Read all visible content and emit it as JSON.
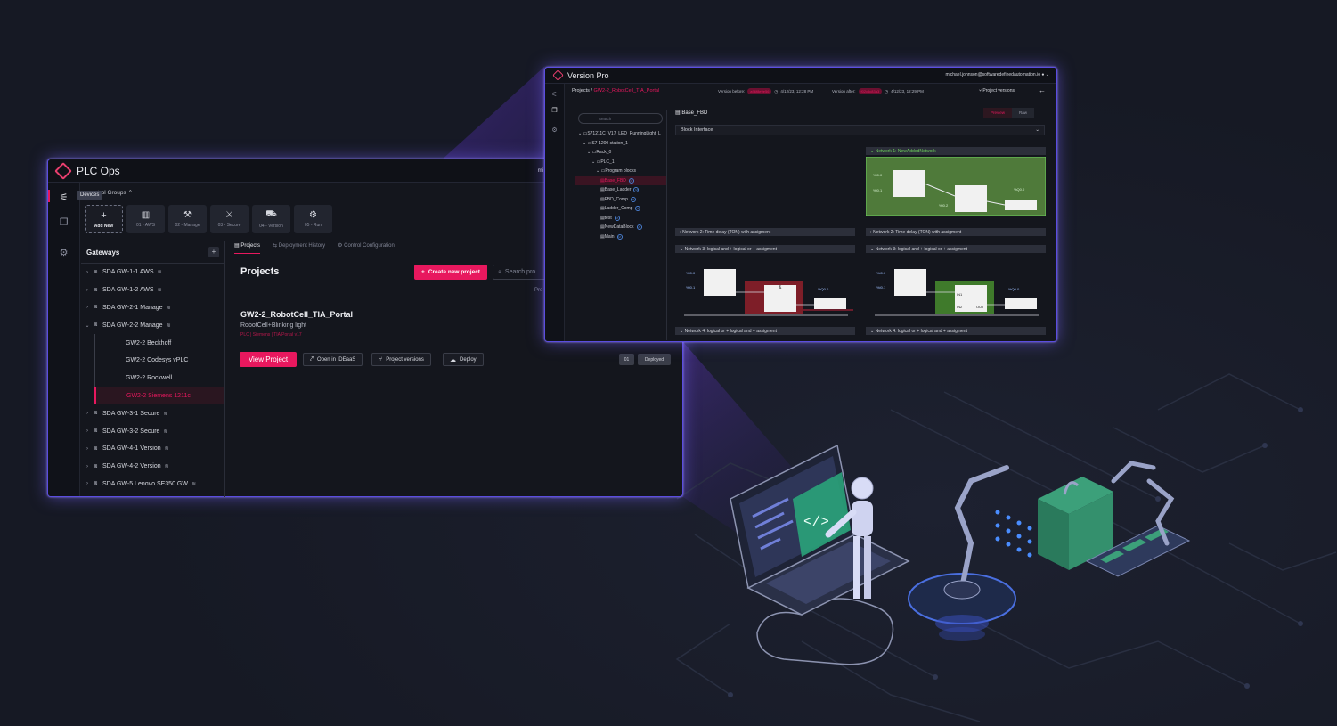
{
  "plc": {
    "title": "PLC Ops",
    "header_user_partial": "mi",
    "tooltip": "Devices",
    "control_groups_label": "ntrol Groups",
    "tiles": [
      {
        "glyph": "+",
        "label": "Add New"
      },
      {
        "glyph": "▥",
        "label": "01 - AWS"
      },
      {
        "glyph": "⚒",
        "label": "02 - Manage"
      },
      {
        "glyph": "⚔",
        "label": "03 - Secure"
      },
      {
        "glyph": "⛟",
        "label": "04 - Version"
      },
      {
        "glyph": "⚙",
        "label": "05 - Run"
      }
    ],
    "gateways_title": "Gateways",
    "gateways": [
      {
        "label": "SDA GW-1-1 AWS",
        "type": "parent"
      },
      {
        "label": "SDA GW-1-2 AWS",
        "type": "parent"
      },
      {
        "label": "SDA GW-2-1 Manage",
        "type": "parent"
      },
      {
        "label": "SDA GW-2-2 Manage",
        "type": "open"
      },
      {
        "label": "GW2-2 Beckhoff",
        "type": "child"
      },
      {
        "label": "GW2-2 Codesys vPLC",
        "type": "child"
      },
      {
        "label": "GW2-2 Rockwell",
        "type": "child"
      },
      {
        "label": "GW2-2 Siemens 1211c",
        "type": "selected"
      },
      {
        "label": "SDA GW-3-1 Secure",
        "type": "parent"
      },
      {
        "label": "SDA GW-3-2 Secure",
        "type": "parent"
      },
      {
        "label": "SDA GW-4-1 Version",
        "type": "parent"
      },
      {
        "label": "SDA GW-4-2 Version",
        "type": "parent"
      },
      {
        "label": "SDA GW-5 Lenovo SE350 GW",
        "type": "parent"
      }
    ],
    "tabs": [
      "Projects",
      "Deployment History",
      "Control Configuration"
    ],
    "page_title": "Projects",
    "create_button": "Create new project",
    "search_placeholder": "Search pro",
    "prefix_text": "Pro",
    "project": {
      "name": "GW2-2_RobotCell_TIA_Portal",
      "subtitle": "RobotCell+Blinking light",
      "tag": "PLC | Siemens | TIA Portal v17",
      "view_button": "View Project",
      "open_button": "Open in IDEaaS",
      "versions_button": "Project versions",
      "deploy_button": "Deploy",
      "version_chip": "01",
      "status_chip": "Deployed"
    }
  },
  "vp": {
    "title": "Version Pro",
    "user": "michael.johnson@softwaredefinedautomation.io",
    "crumb_root": "Projects",
    "crumb_project": "GW2-2_RobotCell_TIA_Portal",
    "version_before_label": "Version before:",
    "version_before_pill": "a96f8e9e56",
    "version_before_time": "4/12/23, 12:28 PM",
    "version_after_label": "Version after:",
    "version_after_pill": "f02c5c83a3",
    "version_after_time": "4/12/23, 12:29 PM",
    "project_versions": "Project versions",
    "search_placeholder": "Search",
    "tree": [
      {
        "label": "S71211C_V17_LED_RunningLight_L",
        "level": 0,
        "badge": ""
      },
      {
        "label": "S7-1200 station_1",
        "level": 1,
        "badge": ""
      },
      {
        "label": "Rack_0",
        "level": 2,
        "badge": ""
      },
      {
        "label": "PLC_1",
        "level": 3,
        "badge": ""
      },
      {
        "label": "Program blocks",
        "level": 4,
        "badge": ""
      },
      {
        "label": "Base_FBD",
        "level": 5,
        "badge": "M",
        "sel": true
      },
      {
        "label": "Base_Ladder",
        "level": 5,
        "badge": "M"
      },
      {
        "label": "FBD_Comp",
        "level": 5,
        "badge": "M"
      },
      {
        "label": "Ladder_Comp",
        "level": 5,
        "badge": "M"
      },
      {
        "label": "test",
        "level": 5,
        "badge": "M"
      },
      {
        "label": "NewDataBlock",
        "level": 5,
        "badge": "A"
      },
      {
        "label": "Main",
        "level": 5,
        "badge": "M"
      }
    ],
    "block_title": "Base_FBD",
    "tab_preview": "Preview",
    "tab_raw": "Raw",
    "block_interface": "Block Interface",
    "net1_added": "Network 1:  NewAddedNetwork",
    "net2_left": "Network 2:  Time delay (TON) with assigment",
    "net2_right": "Network 2:  Time delay (TON) with assigment",
    "net3_left": "Network 3:  logical and + logical or + assigment",
    "net3_right": "Network 3:  logical and + logical or + assigment",
    "net4_left": "Network 4:  logical or + logical and + assigment",
    "net4_right": "Network 4:  logical or + logical and + assigment",
    "diag_labels": {
      "in1": "%I0.0",
      "in1n": "\"I1\"",
      "in2": "%I0.1",
      "in2n": "\"I2\"",
      "in3": "%I0.2",
      "in3n": "\"I3\"",
      "out": "%Q0.0",
      "outn": "\"OutBool\"",
      "and": "&",
      "or": "≥1",
      "assign": "=",
      "x": "X",
      "in1pin": "IN1",
      "in2pin": "IN2",
      "outpin": "OUT"
    }
  }
}
